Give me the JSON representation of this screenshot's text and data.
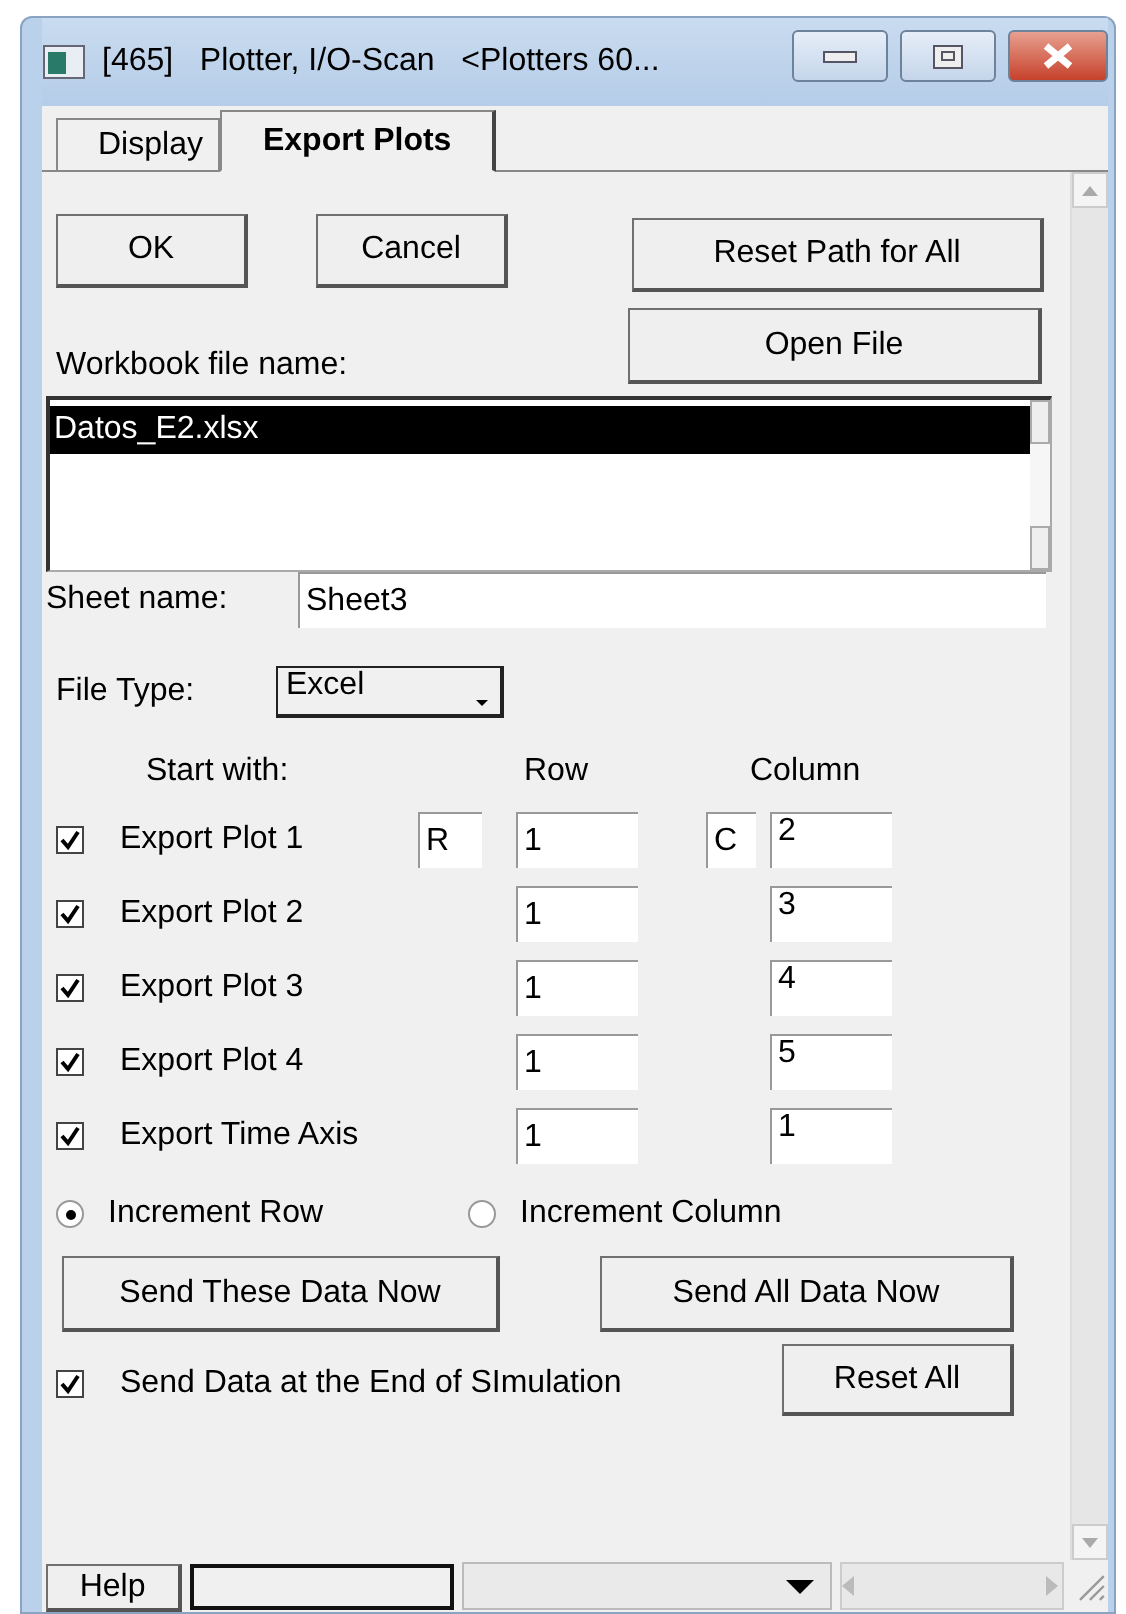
{
  "window": {
    "title": "[465]   Plotter, I/O-Scan   <Plotters 60..."
  },
  "tabs": [
    {
      "label": "Display",
      "selected": false
    },
    {
      "label": "Export Plots",
      "selected": true
    }
  ],
  "top_buttons": [
    "OK",
    "Cancel",
    "Reset Path for All"
  ],
  "open_file_button": "Open File",
  "workbook_label": "Workbook file name:",
  "workbook_files": [
    {
      "name": "Datos_E2.xlsx",
      "selected": true
    }
  ],
  "sheet": {
    "label": "Sheet name:",
    "value": "Sheet3"
  },
  "file_type": {
    "label": "File Type:",
    "value": "Excel"
  },
  "headers": {
    "start_with": "Start with:",
    "row": "Row",
    "column": "Column"
  },
  "exports": [
    {
      "label": "Export Plot 1",
      "checked": true,
      "row_prefix": "R",
      "row": "1",
      "column_prefix": "C",
      "column": "2"
    },
    {
      "label": "Export Plot 2",
      "checked": true,
      "row": "1",
      "column": "3"
    },
    {
      "label": "Export Plot 3",
      "checked": true,
      "row": "1",
      "column": "4"
    },
    {
      "label": "Export Plot 4",
      "checked": true,
      "row": "1",
      "column": "5"
    },
    {
      "label": "Export Time Axis",
      "checked": true,
      "row": "1",
      "column": "1"
    }
  ],
  "increment": [
    {
      "label": "Increment Row",
      "selected": true
    },
    {
      "label": "Increment Column",
      "selected": false
    }
  ],
  "send_buttons": [
    "Send These Data Now",
    "Send All Data Now"
  ],
  "send_at_end": {
    "label": "Send Data at the End of SImulation",
    "checked": true
  },
  "reset_all_button": "Reset All",
  "status_bar": {
    "help_button": "Help"
  }
}
